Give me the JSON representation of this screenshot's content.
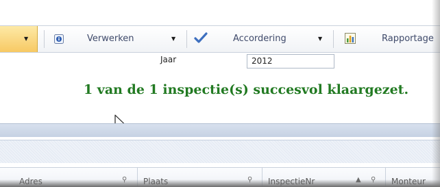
{
  "toolbar": {
    "verwerken_label": "Verwerken",
    "accordering_label": "Accordering",
    "rapportage_label": "Rapportage"
  },
  "filter": {
    "jaar_label": "Jaar",
    "jaar_value": "2012"
  },
  "message": {
    "success": "1 van de 1 inspectie(s) succesvol klaargezet."
  },
  "grid": {
    "columns": [
      {
        "label": "Adres"
      },
      {
        "label": "Plaats"
      },
      {
        "label": "InspectieNr"
      },
      {
        "label": "Monteur"
      }
    ]
  },
  "colors": {
    "success": "#227a22",
    "toolbar_accent": "#f7c964",
    "header_blue": "#c6d2e3"
  },
  "icons": [
    "info-icon",
    "checkmark-icon",
    "chart-icon",
    "dropdown-caret-icon",
    "filter-icon",
    "sort-asc-icon",
    "mouse-pointer-icon"
  ]
}
